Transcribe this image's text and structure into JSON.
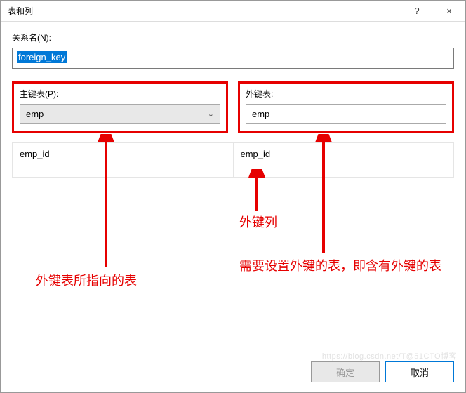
{
  "titlebar": {
    "title": "表和列",
    "help": "?",
    "close": "×"
  },
  "relation": {
    "label": "关系名(N):",
    "value": "foreign_key"
  },
  "primary": {
    "label": "主键表(P):",
    "value": "emp"
  },
  "foreign": {
    "label": "外键表:",
    "value": "emp"
  },
  "columns": {
    "left": "emp_id",
    "right": "emp_id"
  },
  "buttons": {
    "ok": "确定",
    "cancel": "取消"
  },
  "annotations": {
    "fk_col": "外键列",
    "left_note": "外键表所指向的表",
    "right_note": "需要设置外键的表，即含有外键的表"
  },
  "watermark": "https://blog.csdn.net/T@51CTO博客"
}
